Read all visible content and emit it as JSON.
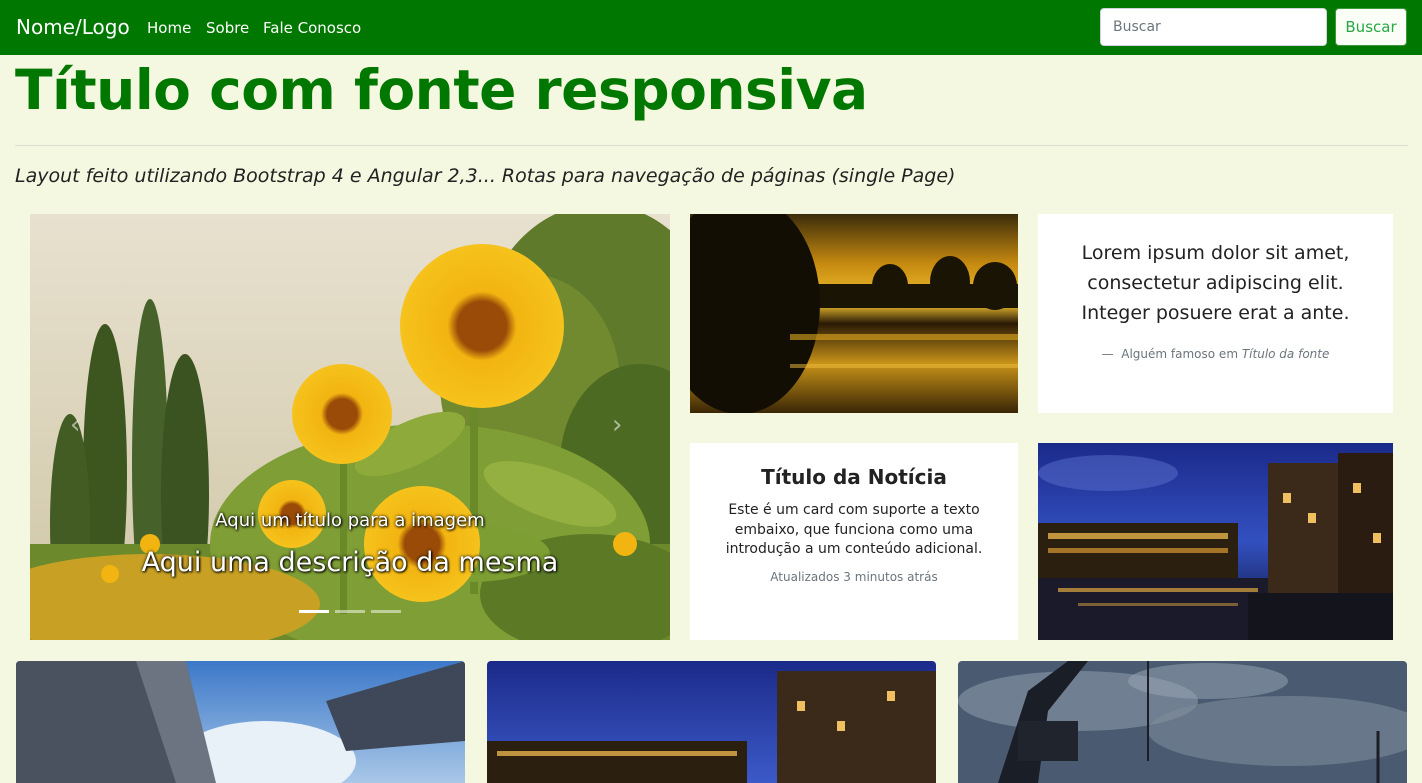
{
  "navbar": {
    "brand": "Nome/Logo",
    "links": [
      "Home",
      "Sobre",
      "Fale Conosco"
    ],
    "search_placeholder": "Buscar",
    "search_button": "Buscar",
    "color": "#007800"
  },
  "header": {
    "title": "Título com fonte responsiva",
    "lead": "Layout feito utilizando Bootstrap 4 e Angular 2,3... Rotas para navegação de páginas (single Page)"
  },
  "carousel": {
    "caption_title": "Aqui um título para a imagem",
    "caption_description": "Aqui uma descrição da mesma",
    "prev_icon": "‹",
    "next_icon": "›",
    "slide_count": 3,
    "active_slide": 1
  },
  "quote_card": {
    "text": "Lorem ipsum dolor sit amet, consectetur adipiscing elit. Integer posuere erat a ante.",
    "dash": "—",
    "author": "Alguém famoso em",
    "source": "Título da fonte"
  },
  "news_card": {
    "title": "Título da Notícia",
    "text": "Este é um card com suporte a texto embaixo, que funciona como uma introdução a um conteúdo adicional.",
    "updated": "Atualizados 3 minutos atrás"
  },
  "images": {
    "carousel_slide": "sunflowers-image",
    "card_1": "sunset-lake-image",
    "card_2": "canal-night-city-image",
    "bottom_1": "skyscrapers-image",
    "bottom_2": "canal-night-city-image",
    "bottom_3": "crane-cloudy-sky-image"
  }
}
